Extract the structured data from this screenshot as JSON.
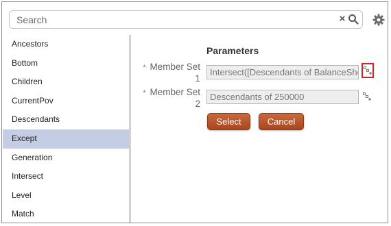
{
  "search": {
    "placeholder": "Search",
    "clear_glyph": "×"
  },
  "icons": {
    "clear": "close-icon",
    "search": "search-icon",
    "settings": "gear-icon",
    "member_selector": "member-selector-icon"
  },
  "functions": {
    "items": [
      {
        "label": "Ancestors"
      },
      {
        "label": "Bottom"
      },
      {
        "label": "Children"
      },
      {
        "label": "CurrentPov"
      },
      {
        "label": "Descendants"
      },
      {
        "label": "Except",
        "selected": true
      },
      {
        "label": "Generation"
      },
      {
        "label": "Intersect"
      },
      {
        "label": "Level"
      },
      {
        "label": "Match"
      }
    ]
  },
  "parameters": {
    "title": "Parameters",
    "required_marker": "*",
    "member_set_1": {
      "label_line1": "Member Set",
      "label_line2": "1",
      "value": "Intersect([Descendants of BalanceSheet]"
    },
    "member_set_2": {
      "label_line1": "Member Set",
      "label_line2": "2",
      "value": "Descendants of 250000"
    }
  },
  "buttons": {
    "select_label": "Select",
    "cancel_label": "Cancel"
  },
  "colors": {
    "button": "#b85630",
    "selected_row": "#c4cde3",
    "highlight_border": "#d2232a"
  }
}
